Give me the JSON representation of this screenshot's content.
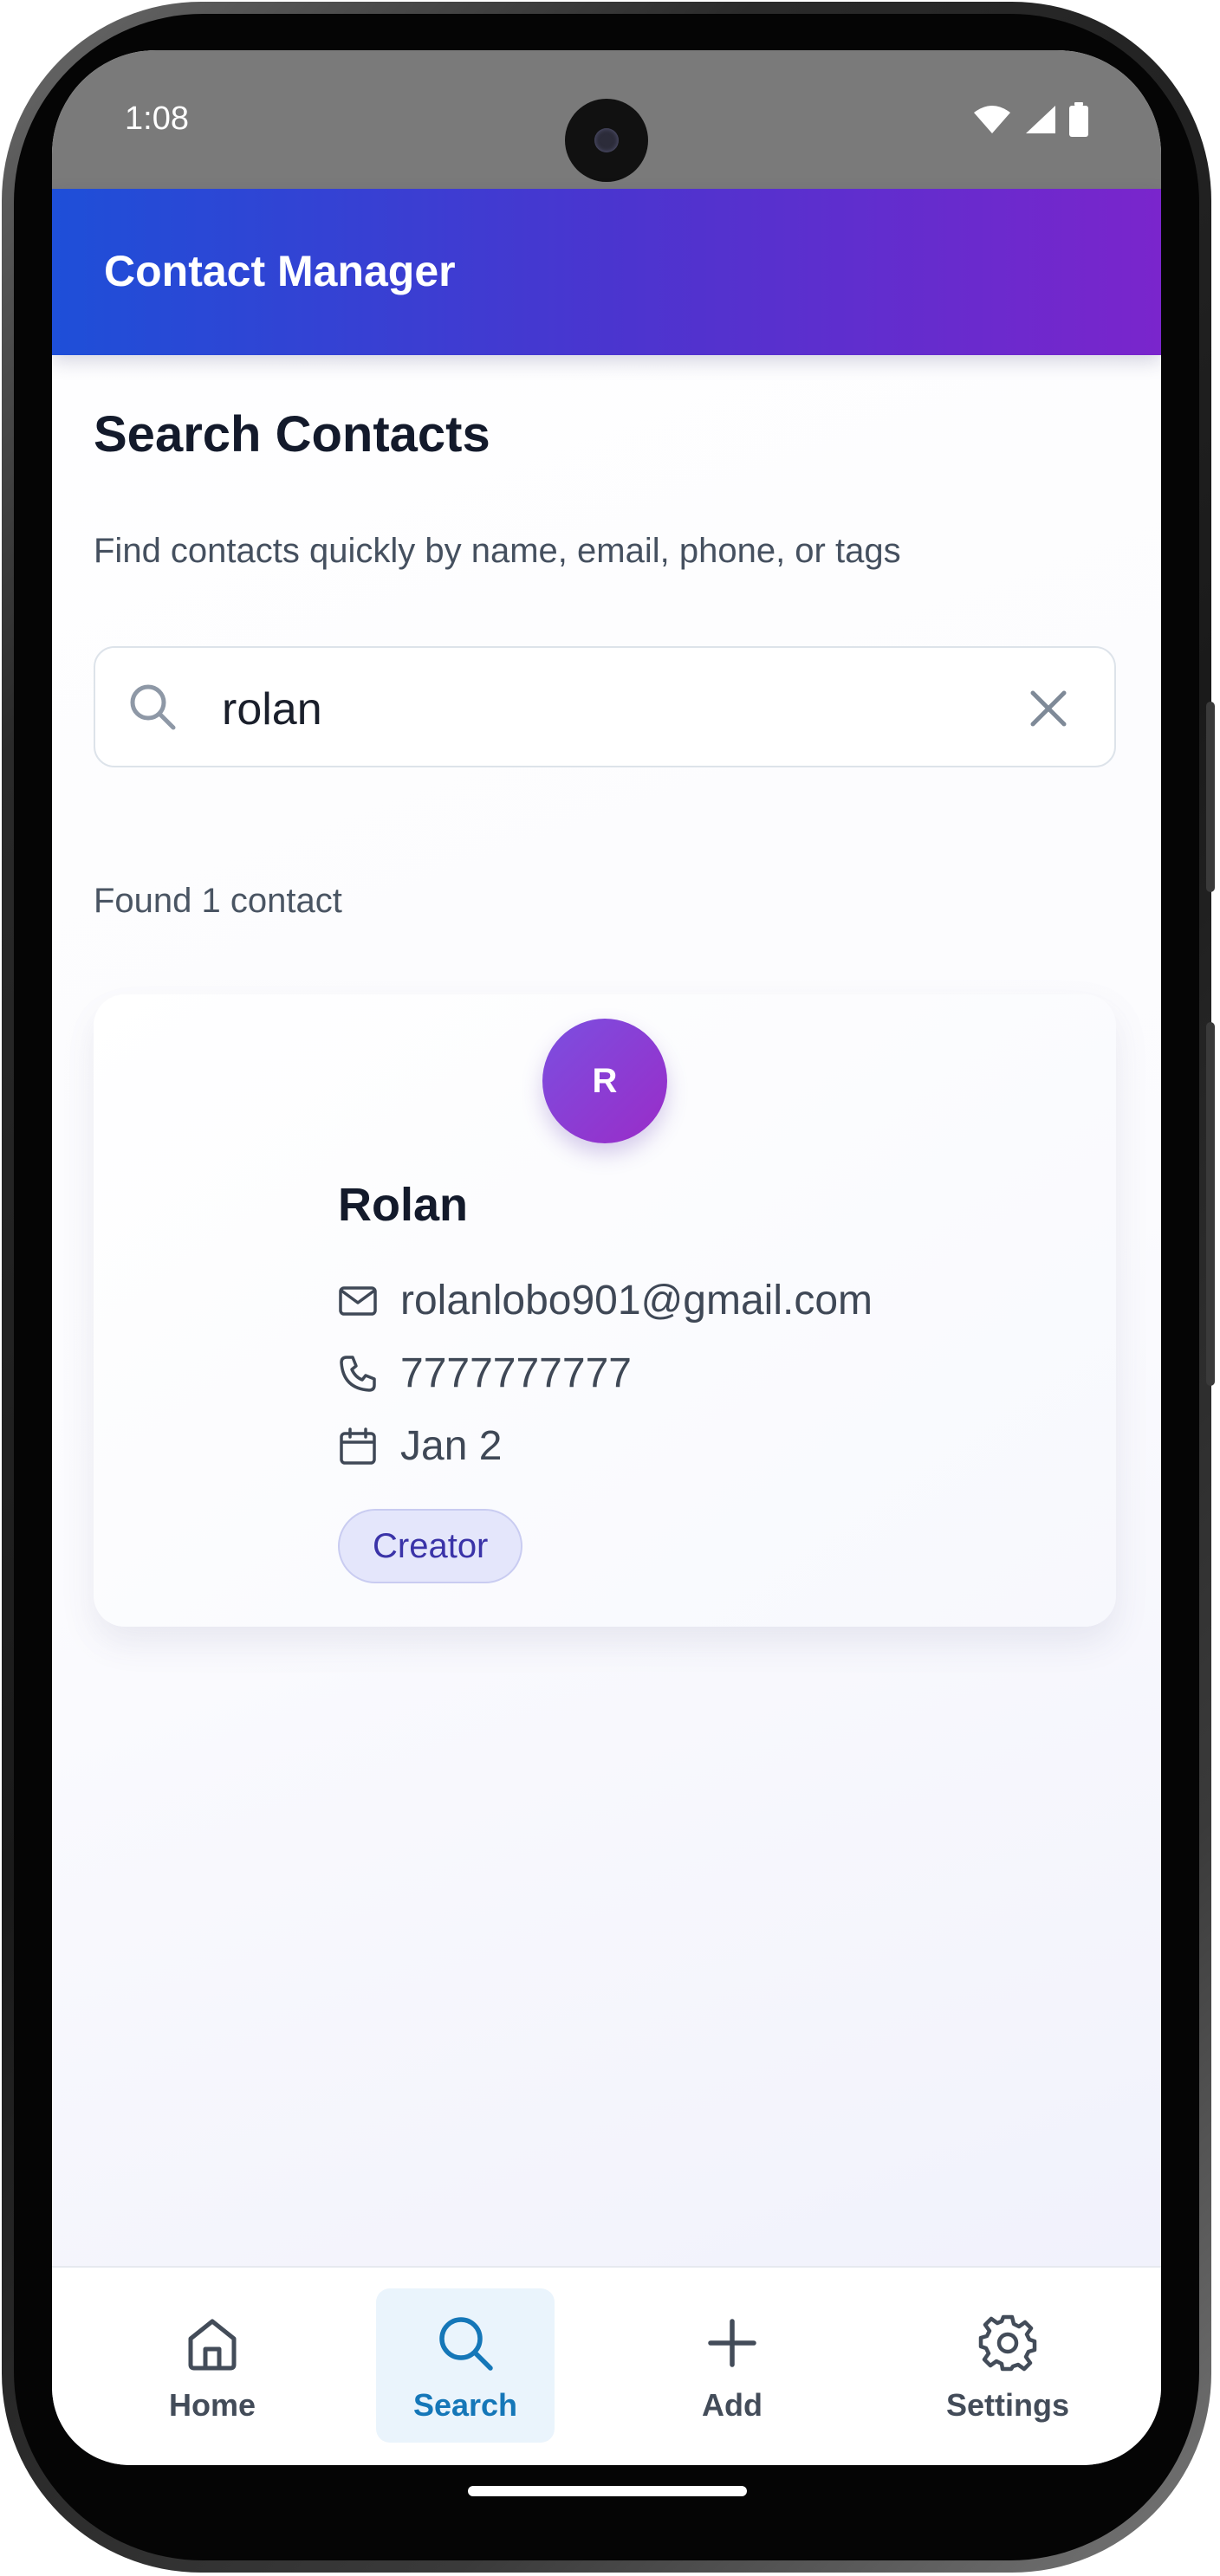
{
  "status_bar": {
    "time": "1:08"
  },
  "app_bar": {
    "title": "Contact Manager"
  },
  "page": {
    "title": "Search Contacts",
    "subtitle": "Find contacts quickly by name, email, phone, or tags"
  },
  "search": {
    "value": "rolan",
    "placeholder": ""
  },
  "results": {
    "count_text": "Found 1 contact",
    "contacts": [
      {
        "initial": "R",
        "name": "Rolan",
        "email": "rolanlobo901@gmail.com",
        "phone": "7777777777",
        "date": "Jan 2",
        "tags": [
          "Creator"
        ]
      }
    ]
  },
  "bottom_nav": {
    "items": [
      {
        "label": "Home",
        "icon": "home-icon",
        "active": false
      },
      {
        "label": "Search",
        "icon": "search-icon",
        "active": true
      },
      {
        "label": "Add",
        "icon": "plus-icon",
        "active": false
      },
      {
        "label": "Settings",
        "icon": "gear-icon",
        "active": false
      }
    ]
  },
  "colors": {
    "app_bar_start": "#1e4fd8",
    "app_bar_end": "#7a25cc",
    "avatar_start": "#7b4fe0",
    "avatar_end": "#9a2cc8",
    "nav_active": "#1577b8",
    "tag_bg": "#e4e6fb",
    "tag_text": "#3a33a8"
  }
}
